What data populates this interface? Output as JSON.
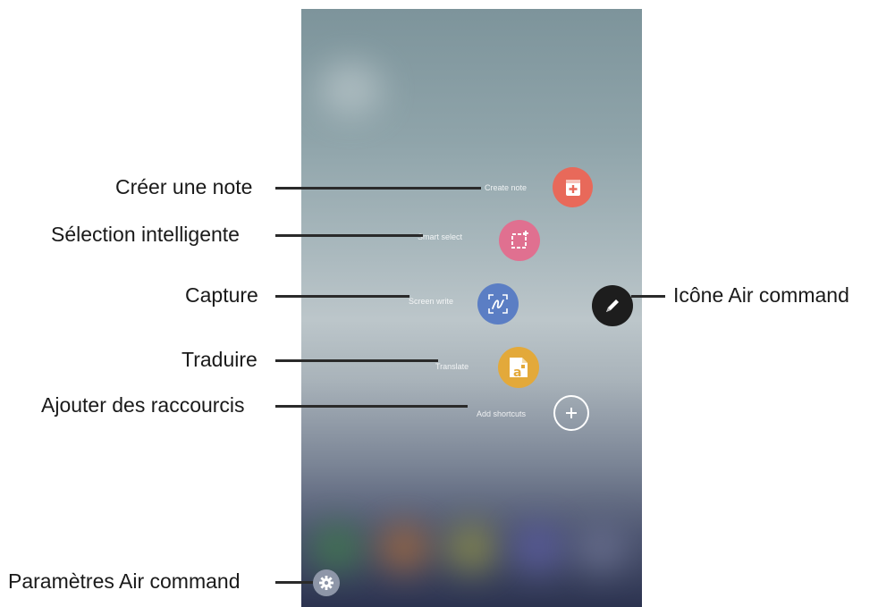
{
  "callouts": {
    "create_note": "Créer une note",
    "smart_select": "Sélection intelligente",
    "screen_write": "Capture",
    "translate": "Traduire",
    "add_shortcuts": "Ajouter des raccourcis",
    "air_command_icon": "Icône Air command",
    "air_command_settings": "Paramètres Air command"
  },
  "menu": [
    {
      "label": "Create note",
      "icon": "create-note-icon",
      "color": "#e8695a"
    },
    {
      "label": "Smart select",
      "icon": "smart-select-icon",
      "color": "#e07090"
    },
    {
      "label": "Screen write",
      "icon": "screen-write-icon",
      "color": "#5b7ec4"
    },
    {
      "label": "Translate",
      "icon": "translate-icon",
      "color": "#e3a93a"
    },
    {
      "label": "Add shortcuts",
      "icon": "plus-icon",
      "color": "transparent"
    }
  ],
  "colors": {
    "air_command": "#1d1d1d",
    "settings": "#8e96a8"
  }
}
